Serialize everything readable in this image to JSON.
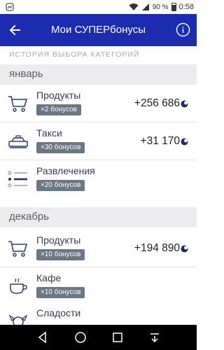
{
  "status": {
    "battery": "90 %",
    "time": "0:58",
    "icons": [
      "wifi-icon",
      "signal-icon",
      "battery-icon"
    ]
  },
  "header": {
    "title": "Мои СУПЕРбонусы",
    "back_icon": "arrow-left-icon",
    "info_icon": "info-icon"
  },
  "section_caption": "ИСТОРИЯ ВЫБОРА КАТЕГОРИЙ",
  "months": [
    {
      "name": "январь",
      "items": [
        {
          "label": "Продукты",
          "badge": "×2 бонусов",
          "amount": "+256 686",
          "icon": "cart-icon"
        },
        {
          "label": "Такси",
          "badge": "×30 бонусов",
          "amount": "+31 170",
          "icon": "taxi-icon"
        },
        {
          "label": "Развлечения",
          "badge": "×20 бонусов",
          "amount": "",
          "icon": "list-icon"
        }
      ]
    },
    {
      "name": "декабрь",
      "items": [
        {
          "label": "Продукты",
          "badge": "×10 бонусов",
          "amount": "+194 890",
          "icon": "cart-icon"
        },
        {
          "label": "Кафе",
          "badge": "×10 бонусов",
          "amount": "",
          "icon": "cup-icon"
        },
        {
          "label": "Сладости",
          "badge": "",
          "amount": "",
          "icon": "candy-icon"
        }
      ]
    }
  ],
  "colors": {
    "header_bg": "#1b2cb0",
    "badge_bg": "#6b7785",
    "month_bg": "#ececef",
    "coin": "#1b2a6b"
  }
}
